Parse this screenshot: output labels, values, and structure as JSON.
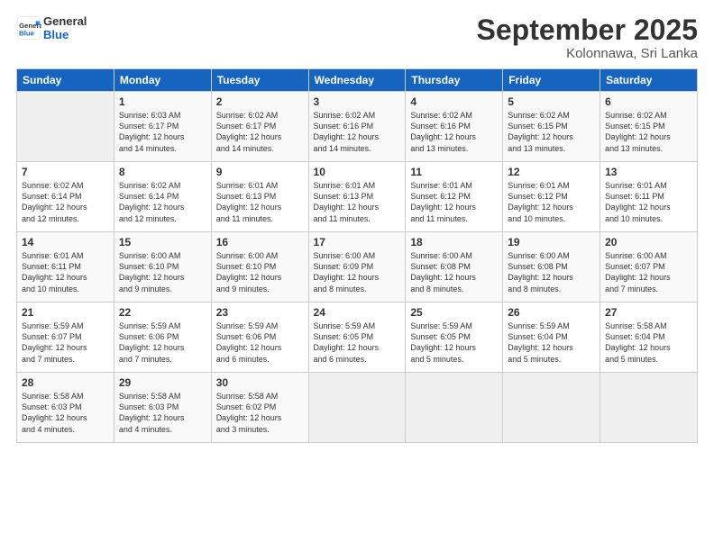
{
  "logo": {
    "line1": "General",
    "line2": "Blue"
  },
  "title": "September 2025",
  "subtitle": "Kolonnawa, Sri Lanka",
  "headers": [
    "Sunday",
    "Monday",
    "Tuesday",
    "Wednesday",
    "Thursday",
    "Friday",
    "Saturday"
  ],
  "weeks": [
    [
      {
        "day": "",
        "info": ""
      },
      {
        "day": "1",
        "info": "Sunrise: 6:03 AM\nSunset: 6:17 PM\nDaylight: 12 hours\nand 14 minutes."
      },
      {
        "day": "2",
        "info": "Sunrise: 6:02 AM\nSunset: 6:17 PM\nDaylight: 12 hours\nand 14 minutes."
      },
      {
        "day": "3",
        "info": "Sunrise: 6:02 AM\nSunset: 6:16 PM\nDaylight: 12 hours\nand 14 minutes."
      },
      {
        "day": "4",
        "info": "Sunrise: 6:02 AM\nSunset: 6:16 PM\nDaylight: 12 hours\nand 13 minutes."
      },
      {
        "day": "5",
        "info": "Sunrise: 6:02 AM\nSunset: 6:15 PM\nDaylight: 12 hours\nand 13 minutes."
      },
      {
        "day": "6",
        "info": "Sunrise: 6:02 AM\nSunset: 6:15 PM\nDaylight: 12 hours\nand 13 minutes."
      }
    ],
    [
      {
        "day": "7",
        "info": "Sunrise: 6:02 AM\nSunset: 6:14 PM\nDaylight: 12 hours\nand 12 minutes."
      },
      {
        "day": "8",
        "info": "Sunrise: 6:02 AM\nSunset: 6:14 PM\nDaylight: 12 hours\nand 12 minutes."
      },
      {
        "day": "9",
        "info": "Sunrise: 6:01 AM\nSunset: 6:13 PM\nDaylight: 12 hours\nand 11 minutes."
      },
      {
        "day": "10",
        "info": "Sunrise: 6:01 AM\nSunset: 6:13 PM\nDaylight: 12 hours\nand 11 minutes."
      },
      {
        "day": "11",
        "info": "Sunrise: 6:01 AM\nSunset: 6:12 PM\nDaylight: 12 hours\nand 11 minutes."
      },
      {
        "day": "12",
        "info": "Sunrise: 6:01 AM\nSunset: 6:12 PM\nDaylight: 12 hours\nand 10 minutes."
      },
      {
        "day": "13",
        "info": "Sunrise: 6:01 AM\nSunset: 6:11 PM\nDaylight: 12 hours\nand 10 minutes."
      }
    ],
    [
      {
        "day": "14",
        "info": "Sunrise: 6:01 AM\nSunset: 6:11 PM\nDaylight: 12 hours\nand 10 minutes."
      },
      {
        "day": "15",
        "info": "Sunrise: 6:00 AM\nSunset: 6:10 PM\nDaylight: 12 hours\nand 9 minutes."
      },
      {
        "day": "16",
        "info": "Sunrise: 6:00 AM\nSunset: 6:10 PM\nDaylight: 12 hours\nand 9 minutes."
      },
      {
        "day": "17",
        "info": "Sunrise: 6:00 AM\nSunset: 6:09 PM\nDaylight: 12 hours\nand 8 minutes."
      },
      {
        "day": "18",
        "info": "Sunrise: 6:00 AM\nSunset: 6:08 PM\nDaylight: 12 hours\nand 8 minutes."
      },
      {
        "day": "19",
        "info": "Sunrise: 6:00 AM\nSunset: 6:08 PM\nDaylight: 12 hours\nand 8 minutes."
      },
      {
        "day": "20",
        "info": "Sunrise: 6:00 AM\nSunset: 6:07 PM\nDaylight: 12 hours\nand 7 minutes."
      }
    ],
    [
      {
        "day": "21",
        "info": "Sunrise: 5:59 AM\nSunset: 6:07 PM\nDaylight: 12 hours\nand 7 minutes."
      },
      {
        "day": "22",
        "info": "Sunrise: 5:59 AM\nSunset: 6:06 PM\nDaylight: 12 hours\nand 7 minutes."
      },
      {
        "day": "23",
        "info": "Sunrise: 5:59 AM\nSunset: 6:06 PM\nDaylight: 12 hours\nand 6 minutes."
      },
      {
        "day": "24",
        "info": "Sunrise: 5:59 AM\nSunset: 6:05 PM\nDaylight: 12 hours\nand 6 minutes."
      },
      {
        "day": "25",
        "info": "Sunrise: 5:59 AM\nSunset: 6:05 PM\nDaylight: 12 hours\nand 5 minutes."
      },
      {
        "day": "26",
        "info": "Sunrise: 5:59 AM\nSunset: 6:04 PM\nDaylight: 12 hours\nand 5 minutes."
      },
      {
        "day": "27",
        "info": "Sunrise: 5:58 AM\nSunset: 6:04 PM\nDaylight: 12 hours\nand 5 minutes."
      }
    ],
    [
      {
        "day": "28",
        "info": "Sunrise: 5:58 AM\nSunset: 6:03 PM\nDaylight: 12 hours\nand 4 minutes."
      },
      {
        "day": "29",
        "info": "Sunrise: 5:58 AM\nSunset: 6:03 PM\nDaylight: 12 hours\nand 4 minutes."
      },
      {
        "day": "30",
        "info": "Sunrise: 5:58 AM\nSunset: 6:02 PM\nDaylight: 12 hours\nand 3 minutes."
      },
      {
        "day": "",
        "info": ""
      },
      {
        "day": "",
        "info": ""
      },
      {
        "day": "",
        "info": ""
      },
      {
        "day": "",
        "info": ""
      }
    ]
  ]
}
